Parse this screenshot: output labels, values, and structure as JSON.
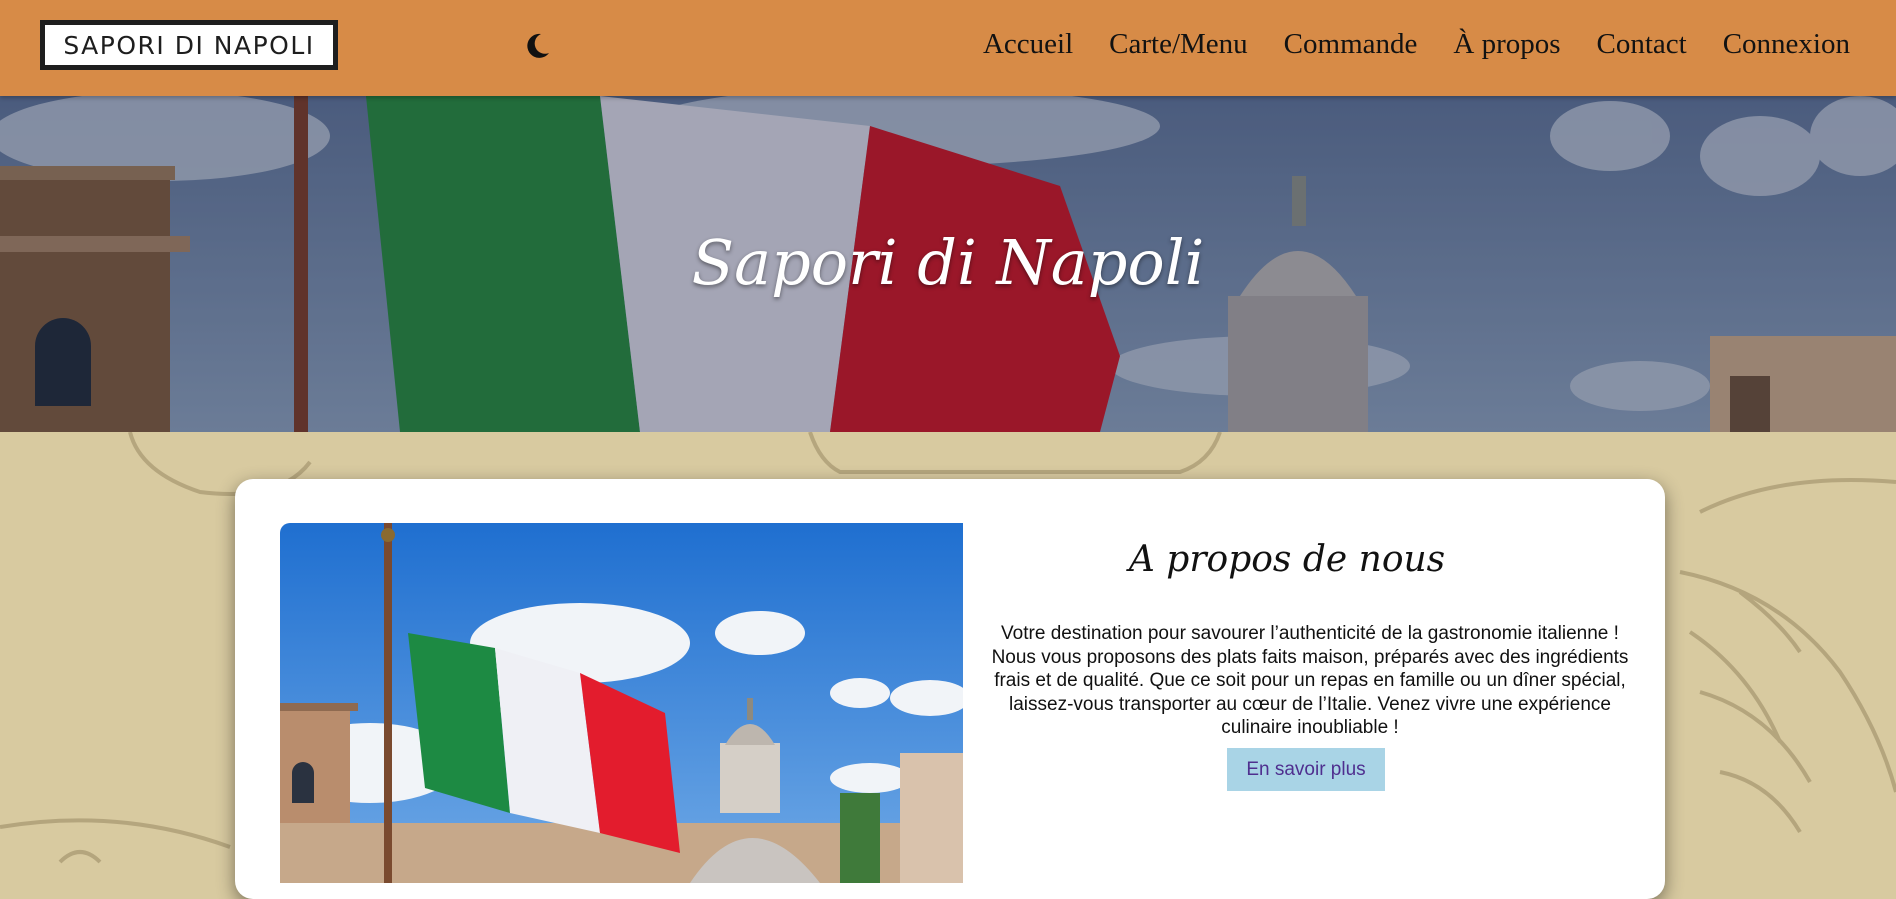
{
  "header": {
    "logo_text": "SAPORI DI NAPOLI",
    "theme_icon": "moon-icon",
    "nav": [
      "Accueil",
      "Carte/Menu",
      "Commande",
      "À propos",
      "Contact",
      "Connexion"
    ]
  },
  "hero": {
    "title": "Sapori di Napoli"
  },
  "about": {
    "title": "A propos de nous",
    "text": "Votre destination pour savourer l’authenticité de la gastronomie italienne ! Nous vous proposons des plats faits maison, préparés avec des ingrédients frais et de qualité. Que ce soit pour un repas en famille ou un dîner spécial, laissez-vous transporter au cœur de l’Italie. Venez vivre une expérience culinaire inoubliable !",
    "button": "En savoir plus"
  },
  "colors": {
    "header_bg": "#d78b47",
    "page_bg": "#d8caa0",
    "button_bg": "#a9d4e6",
    "button_text": "#4f2f8f"
  }
}
